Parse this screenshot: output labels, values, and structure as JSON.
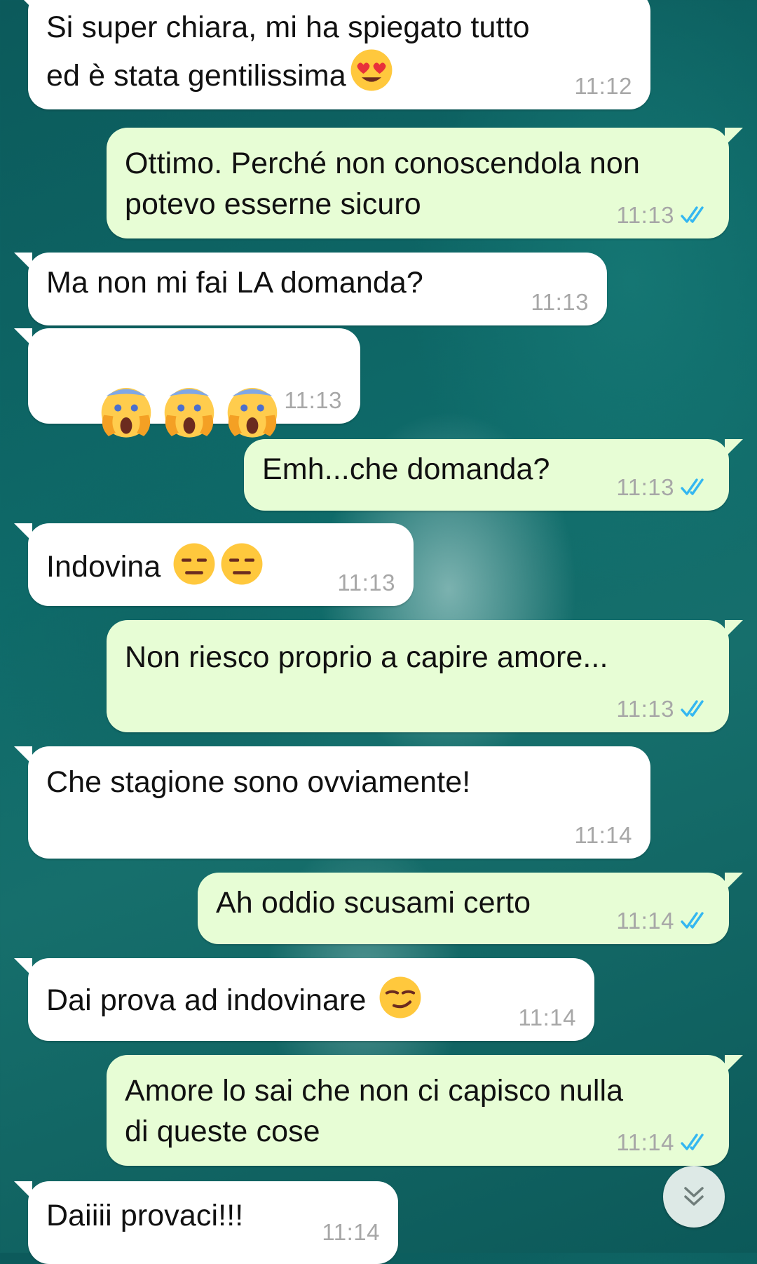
{
  "messages": [
    {
      "text": "Si super chiara, mi ha spiegato tutto\ned è stata gentilissima",
      "time": "11:12",
      "emoji": "heart-eyes-emoji"
    },
    {
      "text": "Ottimo. Perché non conoscendola non\npotevo esserne sicuro",
      "time": "11:13",
      "status": "read"
    },
    {
      "text": "Ma non mi fai LA domanda?",
      "time": "11:13"
    },
    {
      "text": "",
      "time": "11:13",
      "emoji": "screaming-face-emoji x3"
    },
    {
      "text": "Emh...che domanda?",
      "time": "11:13",
      "status": "read"
    },
    {
      "text": "Indovina",
      "time": "11:13",
      "emoji": "expressionless-face-emoji x2"
    },
    {
      "text": "Non riesco proprio a capire amore...",
      "time": "11:13",
      "status": "read"
    },
    {
      "text": "Che stagione sono ovviamente!",
      "time": "11:14"
    },
    {
      "text": "Ah oddio scusami certo",
      "time": "11:14",
      "status": "read"
    },
    {
      "text": "Dai prova ad indovinare",
      "time": "11:14",
      "emoji": "smirking-face-emoji"
    },
    {
      "text": "Amore lo sai che non ci capisco nulla\ndi queste cose",
      "time": "11:14",
      "status": "read"
    },
    {
      "text": "Daiiii provaci!!!",
      "time": "11:14"
    }
  ],
  "colors": {
    "incoming_bubble": "#ffffff",
    "outgoing_bubble": "#e7fdd5",
    "read_tick": "#34b7f1",
    "timestamp": "#a7a7a7"
  },
  "icons": {
    "scroll_down": "double-chevron-down-icon",
    "read_receipt": "double-check-icon"
  }
}
